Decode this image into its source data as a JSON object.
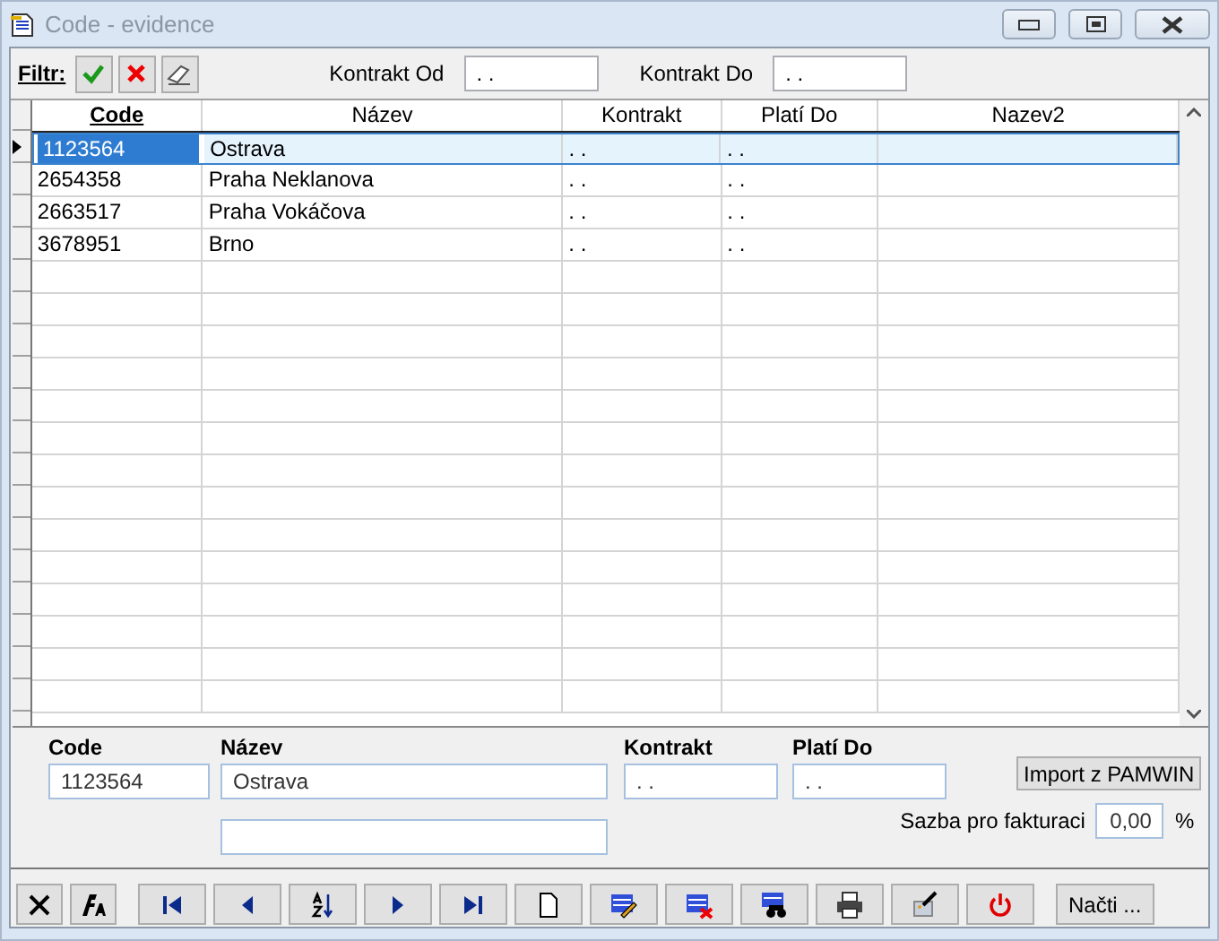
{
  "window": {
    "title": "Code - evidence"
  },
  "filter": {
    "label": "Filtr:",
    "from_label": "Kontrakt Od",
    "from_value": ". .",
    "to_label": "Kontrakt Do",
    "to_value": ". ."
  },
  "table": {
    "columns": [
      {
        "label": "Code",
        "sorted": true
      },
      {
        "label": "Název",
        "sorted": false
      },
      {
        "label": "Kontrakt",
        "sorted": false
      },
      {
        "label": "Platí Do",
        "sorted": false
      },
      {
        "label": "Nazev2",
        "sorted": false
      }
    ],
    "rows": [
      {
        "selected": true,
        "cells": [
          "1123564",
          "Ostrava",
          ". .",
          ". .",
          ""
        ]
      },
      {
        "selected": false,
        "cells": [
          "2654358",
          "Praha Neklanova",
          ". .",
          ". .",
          ""
        ]
      },
      {
        "selected": false,
        "cells": [
          "2663517",
          "Praha Vokáčova",
          ". .",
          ". .",
          ""
        ]
      },
      {
        "selected": false,
        "cells": [
          "3678951",
          "Brno",
          ". .",
          ". .",
          ""
        ]
      }
    ]
  },
  "detail": {
    "code_label": "Code",
    "code_value": "1123564",
    "name_label": "Název",
    "name_value": "Ostrava",
    "kontrakt_label": "Kontrakt",
    "kontrakt_value": ". .",
    "plati_label": "Platí Do",
    "plati_value": ". .",
    "import_button": "Import z PAMWIN",
    "rate_label": "Sazba pro fakturaci",
    "rate_value": "0,00",
    "rate_unit": "%"
  },
  "toolbar": [
    {
      "kind": "cancel"
    },
    {
      "kind": "font"
    },
    {
      "kind": "first"
    },
    {
      "kind": "prev"
    },
    {
      "kind": "sort"
    },
    {
      "kind": "next"
    },
    {
      "kind": "last"
    },
    {
      "kind": "new"
    },
    {
      "kind": "edit"
    },
    {
      "kind": "delete"
    },
    {
      "kind": "find"
    },
    {
      "kind": "print"
    },
    {
      "kind": "tools"
    },
    {
      "kind": "power"
    },
    {
      "kind": "text",
      "label": "Načti ..."
    }
  ]
}
